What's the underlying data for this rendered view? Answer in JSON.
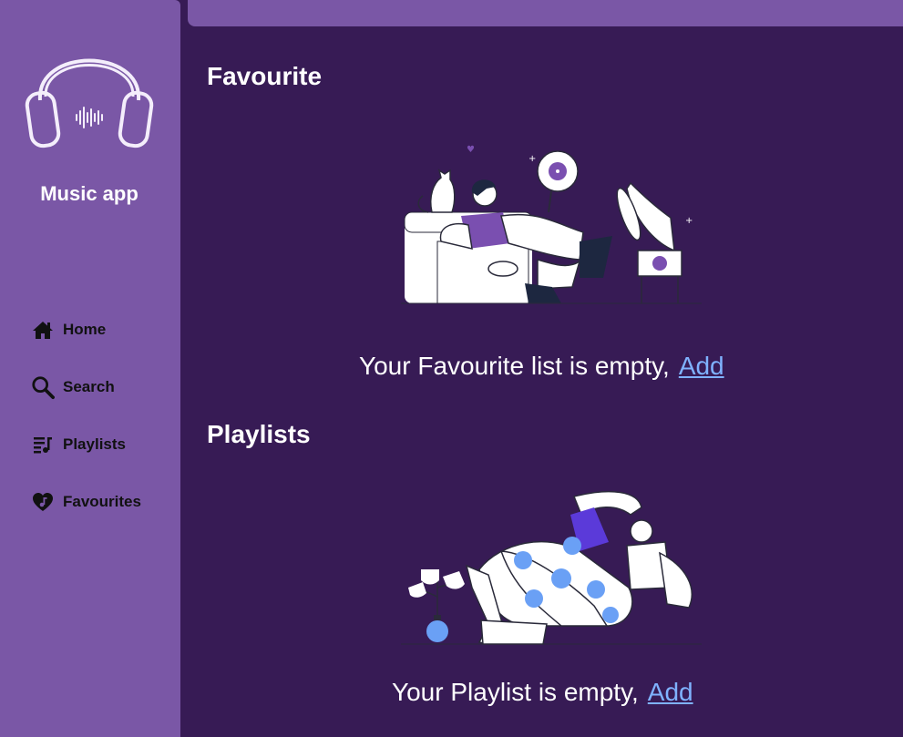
{
  "app": {
    "name": "Music app"
  },
  "nav": {
    "items": [
      {
        "label": "Home",
        "icon": "home-icon"
      },
      {
        "label": "Search",
        "icon": "search-icon"
      },
      {
        "label": "Playlists",
        "icon": "playlist-icon"
      },
      {
        "label": "Favourites",
        "icon": "heart-music-icon"
      }
    ]
  },
  "favourite": {
    "title": "Favourite",
    "empty_text": "Your Favourite list is empty,",
    "add_label": "Add"
  },
  "playlists": {
    "title": "Playlists",
    "empty_text": "Your Playlist is empty,",
    "add_label": "Add"
  },
  "colors": {
    "background": "#371b55",
    "sidebar": "#7a57a6",
    "link": "#7fb2ff",
    "accent_blue": "#6aa0f5"
  }
}
